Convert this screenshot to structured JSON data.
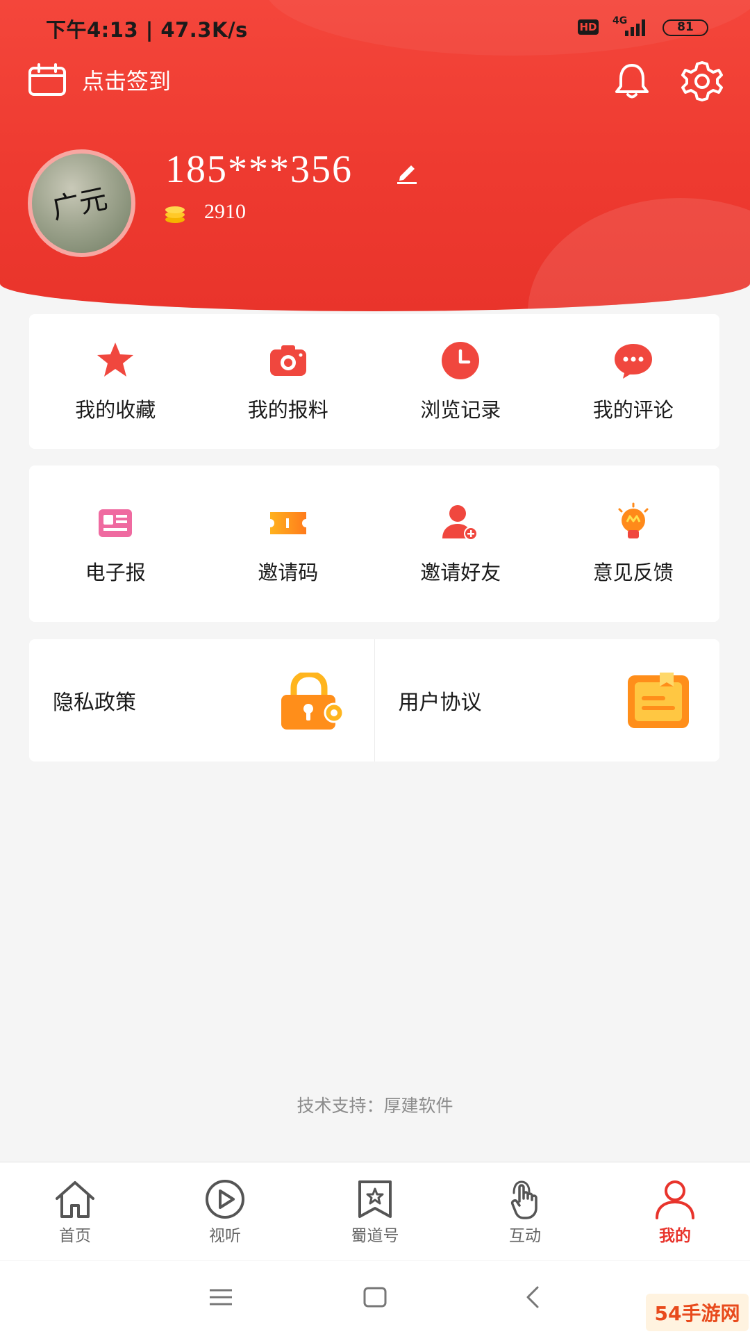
{
  "status_bar": {
    "time": "下午4:13 | 47.3K/s",
    "hd": "HD",
    "network": "4G",
    "battery": "81"
  },
  "header": {
    "checkin_label": "点击签到",
    "avatar_text": "广元",
    "username": "185***356",
    "coins": "2910",
    "accent_color": "#ee3a30"
  },
  "quick_menu": [
    {
      "label": "我的收藏",
      "icon": "star-icon"
    },
    {
      "label": "我的报料",
      "icon": "camera-icon"
    },
    {
      "label": "浏览记录",
      "icon": "clock-icon"
    },
    {
      "label": "我的评论",
      "icon": "comment-icon"
    }
  ],
  "tools_menu": [
    {
      "label": "电子报",
      "icon": "newspaper-icon"
    },
    {
      "label": "邀请码",
      "icon": "ticket-icon"
    },
    {
      "label": "邀请好友",
      "icon": "add-friend-icon"
    },
    {
      "label": "意见反馈",
      "icon": "lightbulb-icon"
    }
  ],
  "policy_links": [
    {
      "label": "隐私政策",
      "icon": "lock-gear-icon"
    },
    {
      "label": "用户协议",
      "icon": "document-icon"
    }
  ],
  "footer_note": "技术支持：厚建软件",
  "tabbar": [
    {
      "label": "首页",
      "icon": "home-icon",
      "active": false
    },
    {
      "label": "视听",
      "icon": "play-icon",
      "active": false
    },
    {
      "label": "蜀道号",
      "icon": "bookmark-star-icon",
      "active": false
    },
    {
      "label": "互动",
      "icon": "tap-icon",
      "active": false
    },
    {
      "label": "我的",
      "icon": "person-icon",
      "active": true
    }
  ],
  "watermark": "54手游网"
}
